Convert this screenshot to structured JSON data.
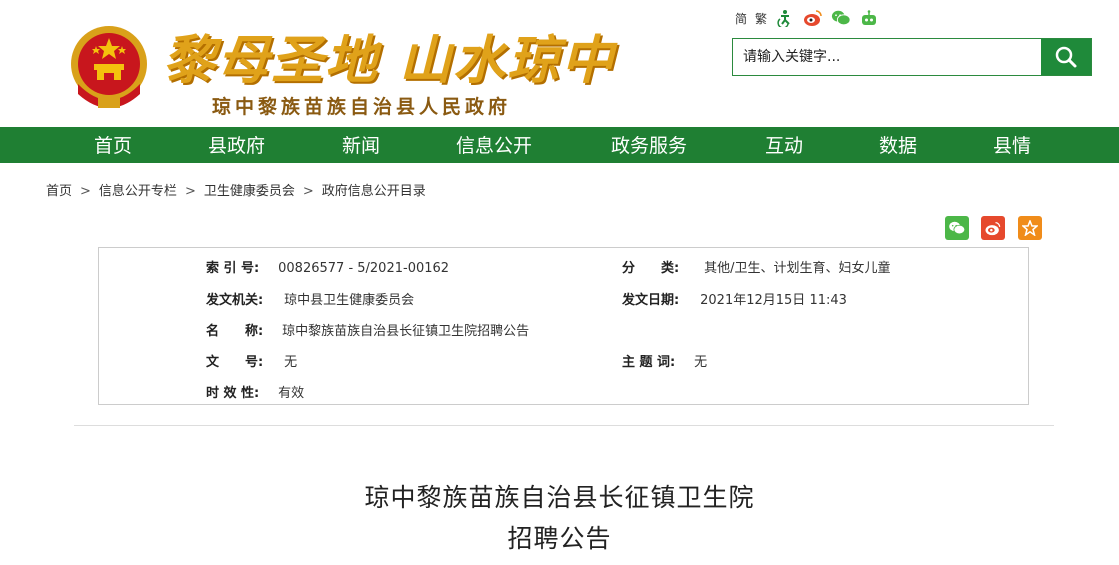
{
  "header": {
    "slogan": "黎母圣地 山水琼中",
    "gov_name": "琼中黎族苗族自治县人民政府",
    "lang_simplified": "简",
    "lang_traditional": "繁",
    "search_placeholder": "请输入关键字..."
  },
  "nav": {
    "items": [
      "首页",
      "县政府",
      "新闻",
      "信息公开",
      "政务服务",
      "互动",
      "数据",
      "县情"
    ]
  },
  "breadcrumb": [
    "首页",
    "信息公开专栏",
    "卫生健康委员会",
    "政府信息公开目录"
  ],
  "breadcrumb_sep": ">",
  "info": {
    "index_label": "索 引 号:",
    "index_value": "00826577 - 5/2021-00162",
    "category_label": "分　　类:",
    "category_value": "其他/卫生、计划生育、妇女儿童",
    "issuer_label": "发文机关:",
    "issuer_value": "琼中县卫生健康委员会",
    "date_label": "发文日期:",
    "date_value": "2021年12月15日 11:43",
    "name_label": "名　　称:",
    "name_value": "琼中黎族苗族自治县长征镇卫生院招聘公告",
    "docno_label": "文　　号:",
    "docno_value": "无",
    "subject_label": "主 题 词:",
    "subject_value": "无",
    "validity_label": "时 效 性:",
    "validity_value": "有效"
  },
  "article": {
    "title_line1": "琼中黎族苗族自治县长征镇卫生院",
    "title_line2": "招聘公告"
  },
  "colors": {
    "nav_green": "#1f7f33",
    "search_button": "#1f8a3a",
    "slogan_gold": "#e0a21a",
    "wechat": "#4cb748",
    "weibo": "#e6492d",
    "favorite": "#f08c1a"
  },
  "icons": [
    "accessibility-icon",
    "weibo-icon",
    "wechat-icon",
    "robot-icon",
    "search-icon"
  ]
}
